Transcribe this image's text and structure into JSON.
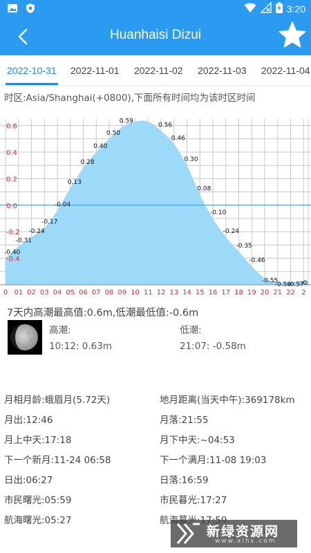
{
  "status_bar": {
    "time": "3:20"
  },
  "header": {
    "title": "Huanhaisi Dizui"
  },
  "tabs": [
    {
      "label": "2022-10-31"
    },
    {
      "label": "2022-11-01"
    },
    {
      "label": "2022-11-02"
    },
    {
      "label": "2022-11-03"
    },
    {
      "label": "2022-11-04"
    }
  ],
  "timezone_note": "时区:Asia/Shanghai(+0800),下面所有时间均为该时区时间",
  "chart_data": {
    "type": "area",
    "x": [
      0,
      1,
      2,
      3,
      4,
      5,
      6,
      7,
      8,
      9,
      10,
      11,
      12,
      13,
      14,
      15,
      16,
      17,
      18,
      19,
      20,
      21,
      22,
      23
    ],
    "values": [
      -0.4,
      -0.31,
      -0.24,
      -0.17,
      -0.04,
      0.13,
      0.28,
      0.4,
      0.5,
      0.59,
      0.63,
      0.63,
      0.56,
      0.46,
      0.3,
      0.08,
      -0.1,
      -0.24,
      -0.35,
      -0.46,
      -0.55,
      -0.58,
      -0.58,
      -0.57
    ],
    "point_labels": [
      "-0.40",
      "-0.31",
      "-0.24",
      "-0.17",
      "-0.04",
      "0.13",
      "0.28",
      "0.40",
      "0.50",
      "0.59",
      "",
      "",
      "0.56",
      "0.46",
      "0.30",
      "0.08",
      "-0.10",
      "-0.24",
      "-0.35",
      "-0.46",
      "-0.55",
      "-0.58",
      "-0.57",
      "-0."
    ],
    "x_tick_labels": [
      "0",
      "01",
      "02",
      "03",
      "04",
      "05",
      "06",
      "07",
      "08",
      "09",
      "10",
      "11",
      "12",
      "13",
      "14",
      "15",
      "16",
      "17",
      "18",
      "19",
      "20",
      "21",
      "22",
      "2"
    ],
    "y_tick_labels": [
      "0.6",
      "0.4",
      "0.2",
      "0.0",
      "-0.2",
      "-0.4"
    ],
    "y_ticks": [
      0.6,
      0.4,
      0.2,
      0.0,
      -0.2,
      -0.4
    ],
    "ylim": [
      -0.6,
      0.65
    ],
    "grid": true,
    "fill_color": "#9dd9f8",
    "tick_color": "#e0282c"
  },
  "summary": "7天内高潮最高值:0.6m,低潮最低值:-0.6m",
  "tide": {
    "high_label": "高潮:",
    "high_value": "10:12: 0.63m",
    "low_label": "低潮:",
    "low_value": "21:07: -0.58m"
  },
  "info_left": [
    "月相月龄:蛾眉月(5.72天)",
    "月出:12:46",
    "月上中天:17:18",
    "下一个新月:11-24 06:58",
    "日出:06:27",
    "市民曙光:05:59",
    "航海曙光:05:27"
  ],
  "info_right": [
    "地月距离(当天中午):369178km",
    "月落:21:55",
    "月下中天:~04:53",
    "下一个满月:11-08 19:03",
    "日落:16:59",
    "市民暮光:17:27",
    "航海暮光:17:59"
  ],
  "watermark": {
    "name": "新绿资源网",
    "url": "www.xlhs.com"
  },
  "colors": {
    "primary": "#2a9bf0",
    "tab_active": "#1a8be0"
  }
}
